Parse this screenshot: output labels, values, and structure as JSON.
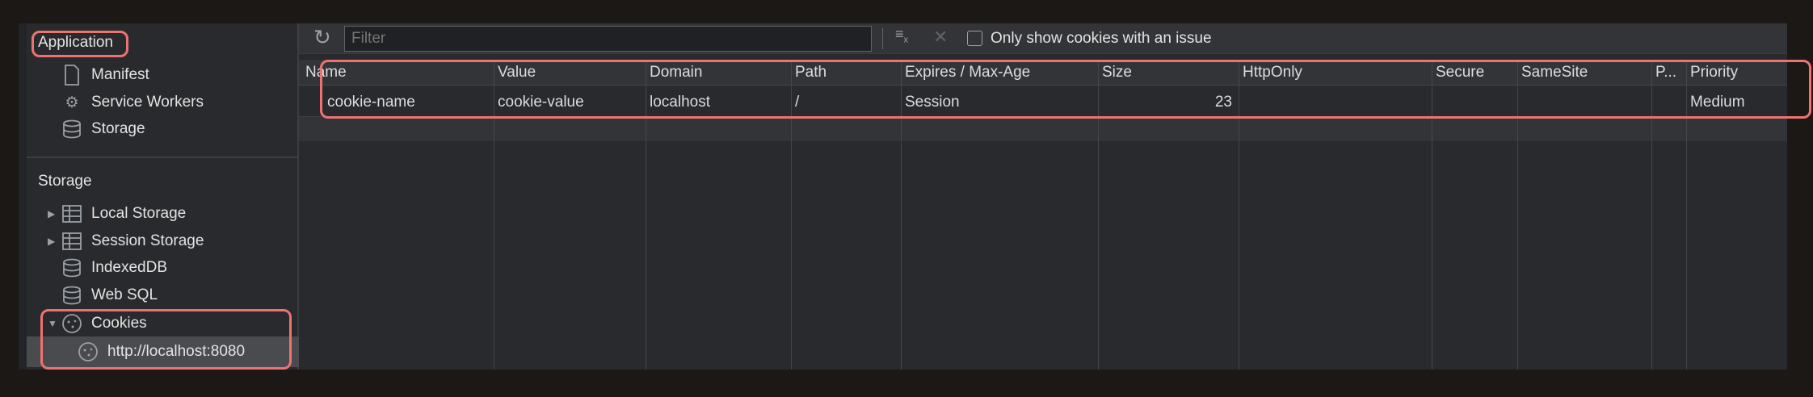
{
  "sidebar": {
    "app_header": "Application",
    "app_items": [
      {
        "label": "Manifest",
        "icon": "document-icon"
      },
      {
        "label": "Service Workers",
        "icon": "gears-icon"
      },
      {
        "label": "Storage",
        "icon": "database-icon"
      }
    ],
    "storage_header": "Storage",
    "storage_items": [
      {
        "label": "Local Storage",
        "icon": "table-icon"
      },
      {
        "label": "Session Storage",
        "icon": "table-icon"
      },
      {
        "label": "IndexedDB",
        "icon": "database-icon"
      },
      {
        "label": "Web SQL",
        "icon": "database-icon"
      },
      {
        "label": "Cookies",
        "icon": "cookie-icon"
      }
    ],
    "cookie_origin": "http://localhost:8080"
  },
  "toolbar": {
    "filter_placeholder": "Filter",
    "only_issues_label": "Only show cookies with an issue"
  },
  "table": {
    "columns": [
      "Name",
      "Value",
      "Domain",
      "Path",
      "Expires / Max-Age",
      "Size",
      "HttpOnly",
      "Secure",
      "SameSite",
      "P...",
      "Priority"
    ],
    "rows": [
      [
        "cookie-name",
        "cookie-value",
        "localhost",
        "/",
        "Session",
        "23",
        "",
        "",
        "",
        "",
        "Medium"
      ]
    ]
  },
  "colors": {
    "highlight": "#ee7370",
    "selected": "#4a4b4e"
  }
}
